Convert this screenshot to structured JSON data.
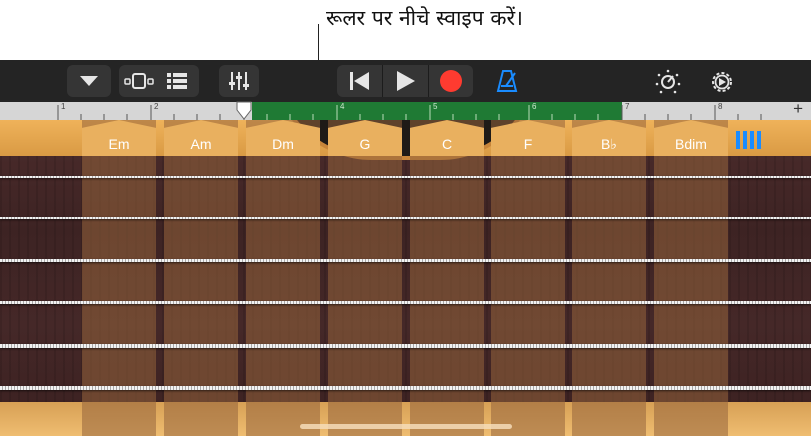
{
  "callout": {
    "text": "रूलर पर नीचे स्वाइप करें।"
  },
  "toolbar": {
    "left_icons": [
      "dropdown-arrow-icon",
      "browser-view-icon",
      "tracks-view-icon",
      "mixer-icon"
    ],
    "transport_icons": [
      "go-to-beginning-icon",
      "play-icon",
      "record-icon"
    ],
    "metronome_icon": "metronome-icon",
    "right_icons": [
      "master-effects-icon",
      "settings-icon"
    ],
    "colors": {
      "record": "#ff3b30",
      "metronome": "#1a8cff",
      "background": "#242424"
    }
  },
  "ruler": {
    "bars": [
      "1",
      "2",
      "3",
      "4",
      "5",
      "6",
      "7",
      "8"
    ],
    "add_label": "+",
    "cycle_region_color": "#1f7a34"
  },
  "chords": [
    "Em",
    "Am",
    "Dm",
    "G",
    "C",
    "F",
    "B♭",
    "Bdim"
  ],
  "strings_toggle_icon": "chord-strings-icon",
  "colors": {
    "accent": "#1a8cff",
    "wood": "#e9b05f",
    "fretboard": "#3d2323"
  }
}
